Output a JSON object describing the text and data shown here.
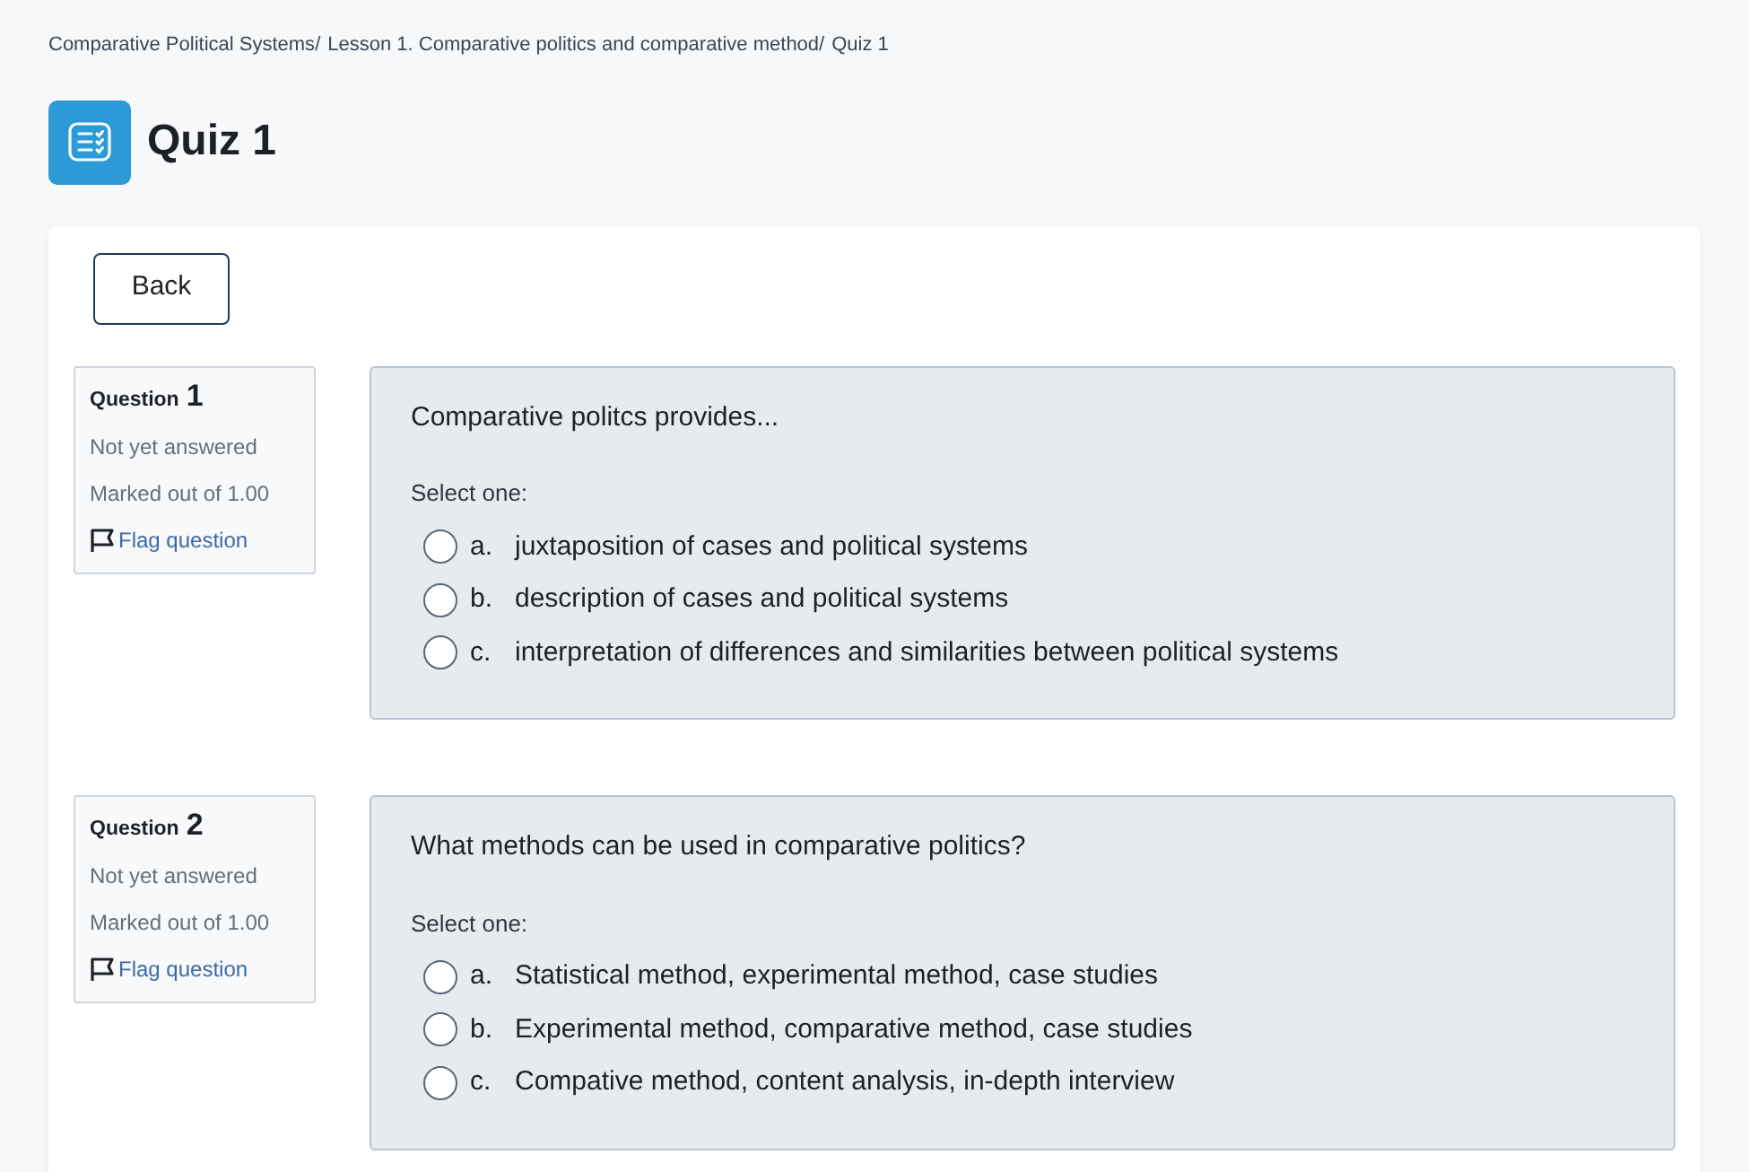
{
  "breadcrumb": [
    {
      "label": "Comparative Political Systems",
      "separator": "/"
    },
    {
      "label": "Lesson 1. Comparative politics and comparative method",
      "separator": "/"
    },
    {
      "label": "Quiz 1"
    }
  ],
  "page_title": "Quiz 1",
  "back_button": "Back",
  "questions": [
    {
      "label": "Question",
      "number": "1",
      "status": "Not yet answered",
      "marks": "Marked out of 1.00",
      "flag": {
        "label": "Flag question",
        "flagged": false
      },
      "text": "Comparative politcs provides...",
      "prompt": "Select one:",
      "options": [
        {
          "letter": "a.",
          "text": "juxtaposition of cases and political systems",
          "selected": false
        },
        {
          "letter": "b.",
          "text": "description of cases and political systems",
          "selected": false
        },
        {
          "letter": "c.",
          "text": "interpretation of differences and similarities between political systems",
          "selected": false
        }
      ]
    },
    {
      "label": "Question",
      "number": "2",
      "status": "Not yet answered",
      "marks": "Marked out of 1.00",
      "flag": {
        "label": "Flag question",
        "flagged": false
      },
      "text": "What methods can be used in comparative politics?",
      "prompt": "Select one:",
      "options": [
        {
          "letter": "a.",
          "text": "Statistical method, experimental method, case studies",
          "selected": false
        },
        {
          "letter": "b.",
          "text": "Experimental method, comparative method, case studies",
          "selected": false
        },
        {
          "letter": "c.",
          "text": "Compative method, content analysis, in-depth interview",
          "selected": false
        }
      ]
    }
  ]
}
